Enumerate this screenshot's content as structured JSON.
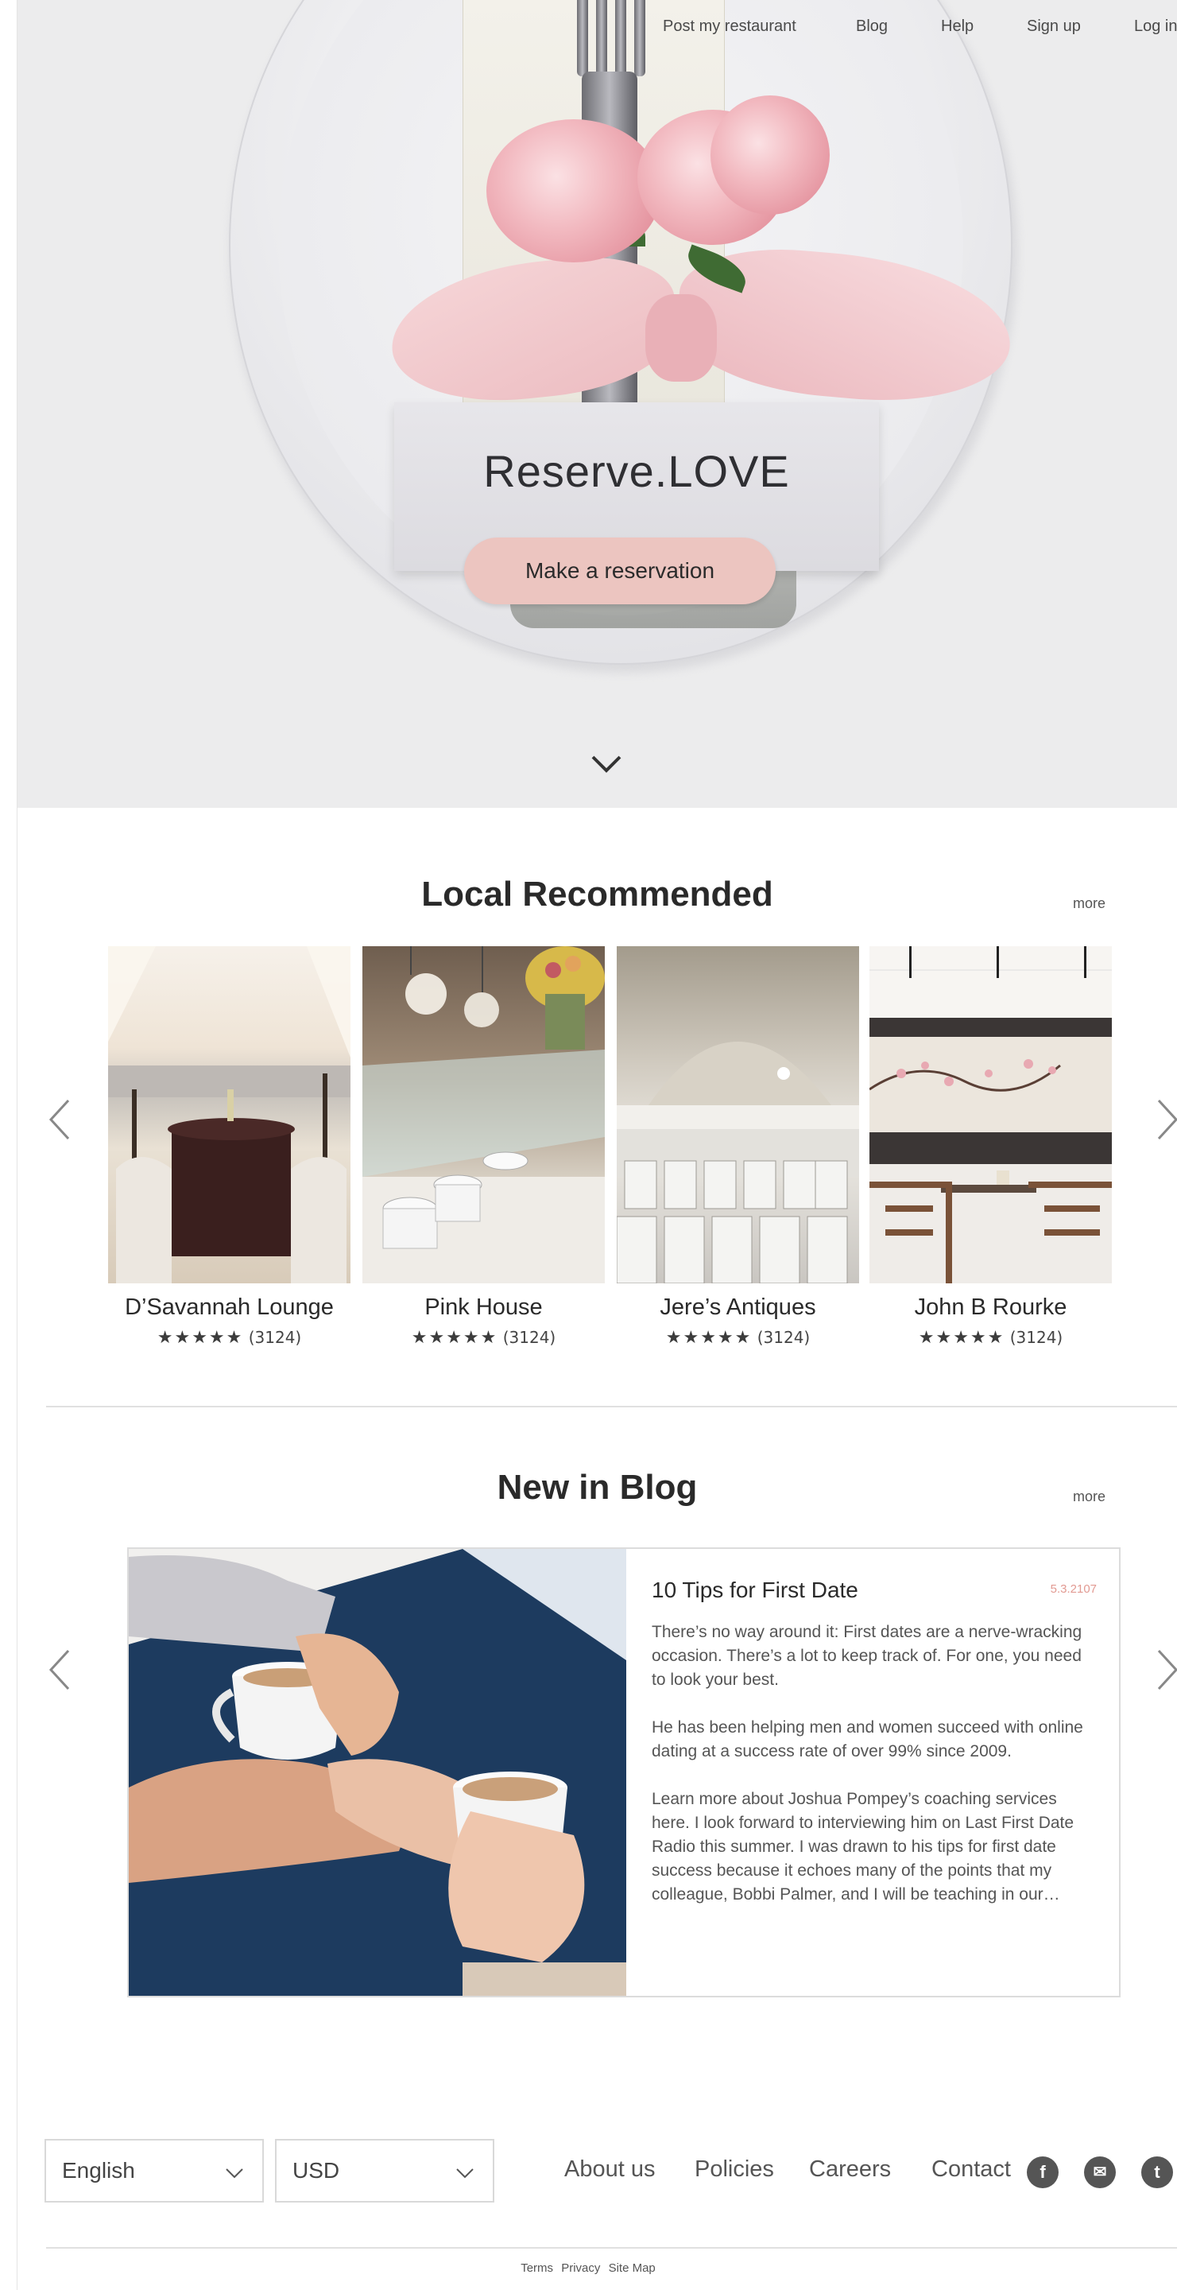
{
  "top_nav": {
    "items": [
      "Post my restaurant",
      "Blog",
      "Help",
      "Sign up",
      "Log in"
    ]
  },
  "hero": {
    "brand": "Reserve.LOVE",
    "cta_label": "Make a reservation",
    "scroll_icon": "chevron-down-icon"
  },
  "local": {
    "title": "Local Recommended",
    "more": "more",
    "prev_icon": "chevron-left-icon",
    "next_icon": "chevron-right-icon",
    "restaurants": [
      {
        "name": "D’Savannah Lounge",
        "stars": "★★★★★",
        "reviews": "(3124)"
      },
      {
        "name": "Pink House",
        "stars": "★★★★★",
        "reviews": "(3124)"
      },
      {
        "name": "Jere’s Antiques",
        "stars": "★★★★★",
        "reviews": "(3124)"
      },
      {
        "name": "John B Rourke",
        "stars": "★★★★★",
        "reviews": "(3124)"
      }
    ]
  },
  "blog": {
    "title": "New in Blog",
    "more": "more",
    "post": {
      "title": "10 Tips for First Date",
      "date": "5.3.2107",
      "paragraphs": [
        "There’s no way around it: First dates are a nerve-wracking occasion. There’s a lot to keep track of. For one, you need to look your best.",
        "He has been helping men and women succeed with online dating at a success rate of over 99% since 2009.",
        "Learn more about Joshua Pompey’s coaching services here. I look forward to interviewing him on Last First Date Radio this summer. I was drawn to his tips for first date success because it echoes many of the points that my colleague, Bobbi Palmer, and I will be teaching in our…"
      ]
    }
  },
  "footer": {
    "language": "English",
    "currency": "USD",
    "links": [
      "About us",
      "Policies",
      "Careers",
      "Contact"
    ],
    "social": [
      {
        "icon": "facebook-icon",
        "glyph": "f"
      },
      {
        "icon": "email-icon",
        "glyph": "✉"
      },
      {
        "icon": "tumblr-icon",
        "glyph": "t"
      }
    ],
    "legal": [
      "Terms",
      "Privacy",
      "Site Map"
    ]
  },
  "colors": {
    "accent_pink": "#ecc5c0",
    "date_pink": "#e29a92",
    "hero_bg": "#ececed"
  }
}
